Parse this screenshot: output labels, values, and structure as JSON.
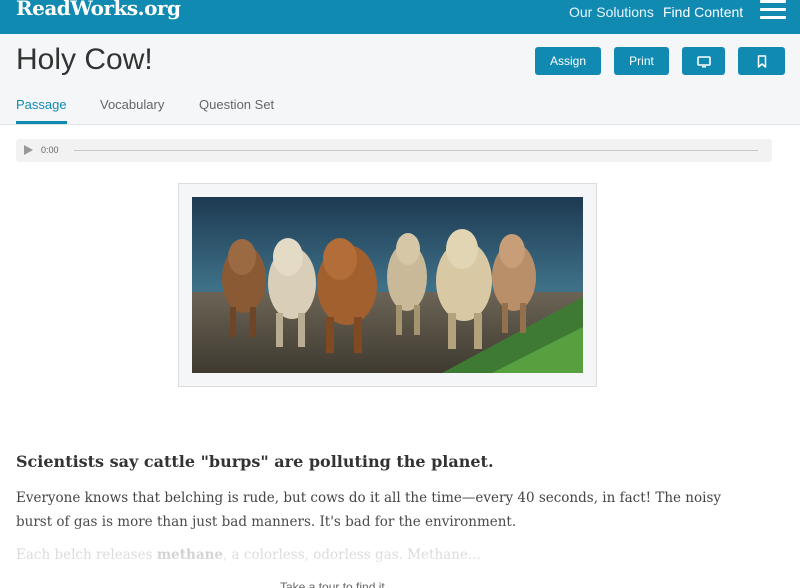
{
  "topbar": {
    "logo": "ReadWorks.org",
    "nav": [
      "Our Solutions",
      "Find Content"
    ],
    "menu_icon": "hamburger-icon"
  },
  "header": {
    "title": "Holy Cow!",
    "buttons": {
      "assign": "Assign",
      "print": "Print",
      "present_icon": "monitor-icon",
      "bookmark_icon": "bookmark-icon"
    },
    "tabs": [
      "Passage",
      "Vocabulary",
      "Question Set"
    ],
    "active_tab": "Passage"
  },
  "audio": {
    "time": "0:00",
    "play_icon": "play-icon"
  },
  "article": {
    "image_alt": "cows",
    "subhead": "Scientists say cattle \"burps\" are polluting the planet.",
    "para1": "Everyone knows that belching is rude, but cows do it all the time—every 40 seconds, in fact! The noisy burst of gas is more than just bad manners. It's bad for the environment.",
    "para2_start": "Each belch releases ",
    "para2_bold": "methane",
    "para2_end": ", a colorless, odorless gas. Methane...",
    "more_link": "Take a tour to find it..."
  },
  "colors": {
    "brand": "#118ab2",
    "header_bg": "#f4f6f7"
  }
}
